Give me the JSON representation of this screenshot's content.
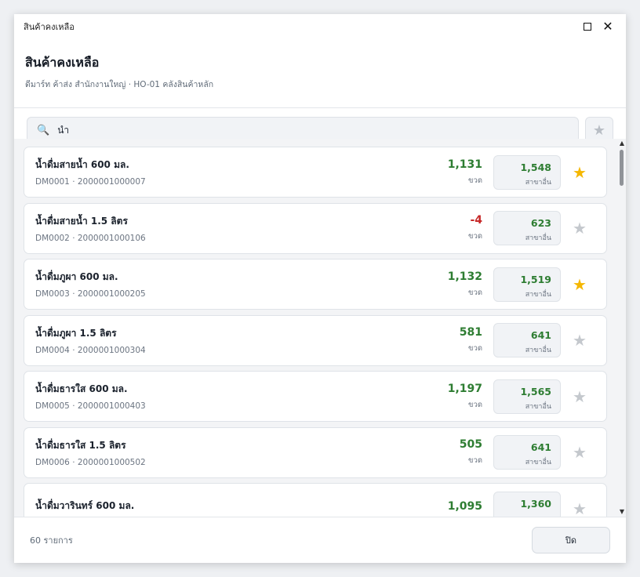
{
  "window": {
    "title": "สินค้าคงเหลือ"
  },
  "header": {
    "title": "สินค้าคงเหลือ",
    "subtitle": "ดีมาร์ท ค้าส่ง สำนักงานใหญ่  ·  HO-01 คลังสินค้าหลัก"
  },
  "search": {
    "value": "น้ำ",
    "icon": "search-icon"
  },
  "colors": {
    "positive": "#2e7d32",
    "negative": "#c62828",
    "star_on": "#f5b700",
    "star_off": "#c4c8cd"
  },
  "items": [
    {
      "name": "น้ำดื่มสายน้ำ 600 มล.",
      "codes": "DM0001  ·  2000001000007",
      "qty": "1,131",
      "unit": "ขวด",
      "other": "1,548",
      "other_label": "สาขาอื่น",
      "favorite": true,
      "negative": false
    },
    {
      "name": "น้ำดื่มสายน้ำ 1.5 ลิตร",
      "codes": "DM0002  ·  2000001000106",
      "qty": "-4",
      "unit": "ขวด",
      "other": "623",
      "other_label": "สาขาอื่น",
      "favorite": false,
      "negative": true
    },
    {
      "name": "น้ำดื่มภูผา 600 มล.",
      "codes": "DM0003  ·  2000001000205",
      "qty": "1,132",
      "unit": "ขวด",
      "other": "1,519",
      "other_label": "สาขาอื่น",
      "favorite": true,
      "negative": false
    },
    {
      "name": "น้ำดื่มภูผา 1.5 ลิตร",
      "codes": "DM0004  ·  2000001000304",
      "qty": "581",
      "unit": "ขวด",
      "other": "641",
      "other_label": "สาขาอื่น",
      "favorite": false,
      "negative": false
    },
    {
      "name": "น้ำดื่มธารใส 600 มล.",
      "codes": "DM0005  ·  2000001000403",
      "qty": "1,197",
      "unit": "ขวด",
      "other": "1,565",
      "other_label": "สาขาอื่น",
      "favorite": false,
      "negative": false
    },
    {
      "name": "น้ำดื่มธารใส 1.5 ลิตร",
      "codes": "DM0006  ·  2000001000502",
      "qty": "505",
      "unit": "ขวด",
      "other": "641",
      "other_label": "สาขาอื่น",
      "favorite": false,
      "negative": false
    },
    {
      "name": "น้ำดื่มวารินทร์ 600 มล.",
      "codes": "",
      "qty": "1,095",
      "unit": "",
      "other": "1,360",
      "other_label": "",
      "favorite": false,
      "negative": false
    }
  ],
  "footer": {
    "count": "60 รายการ",
    "close_label": "ปิด"
  }
}
